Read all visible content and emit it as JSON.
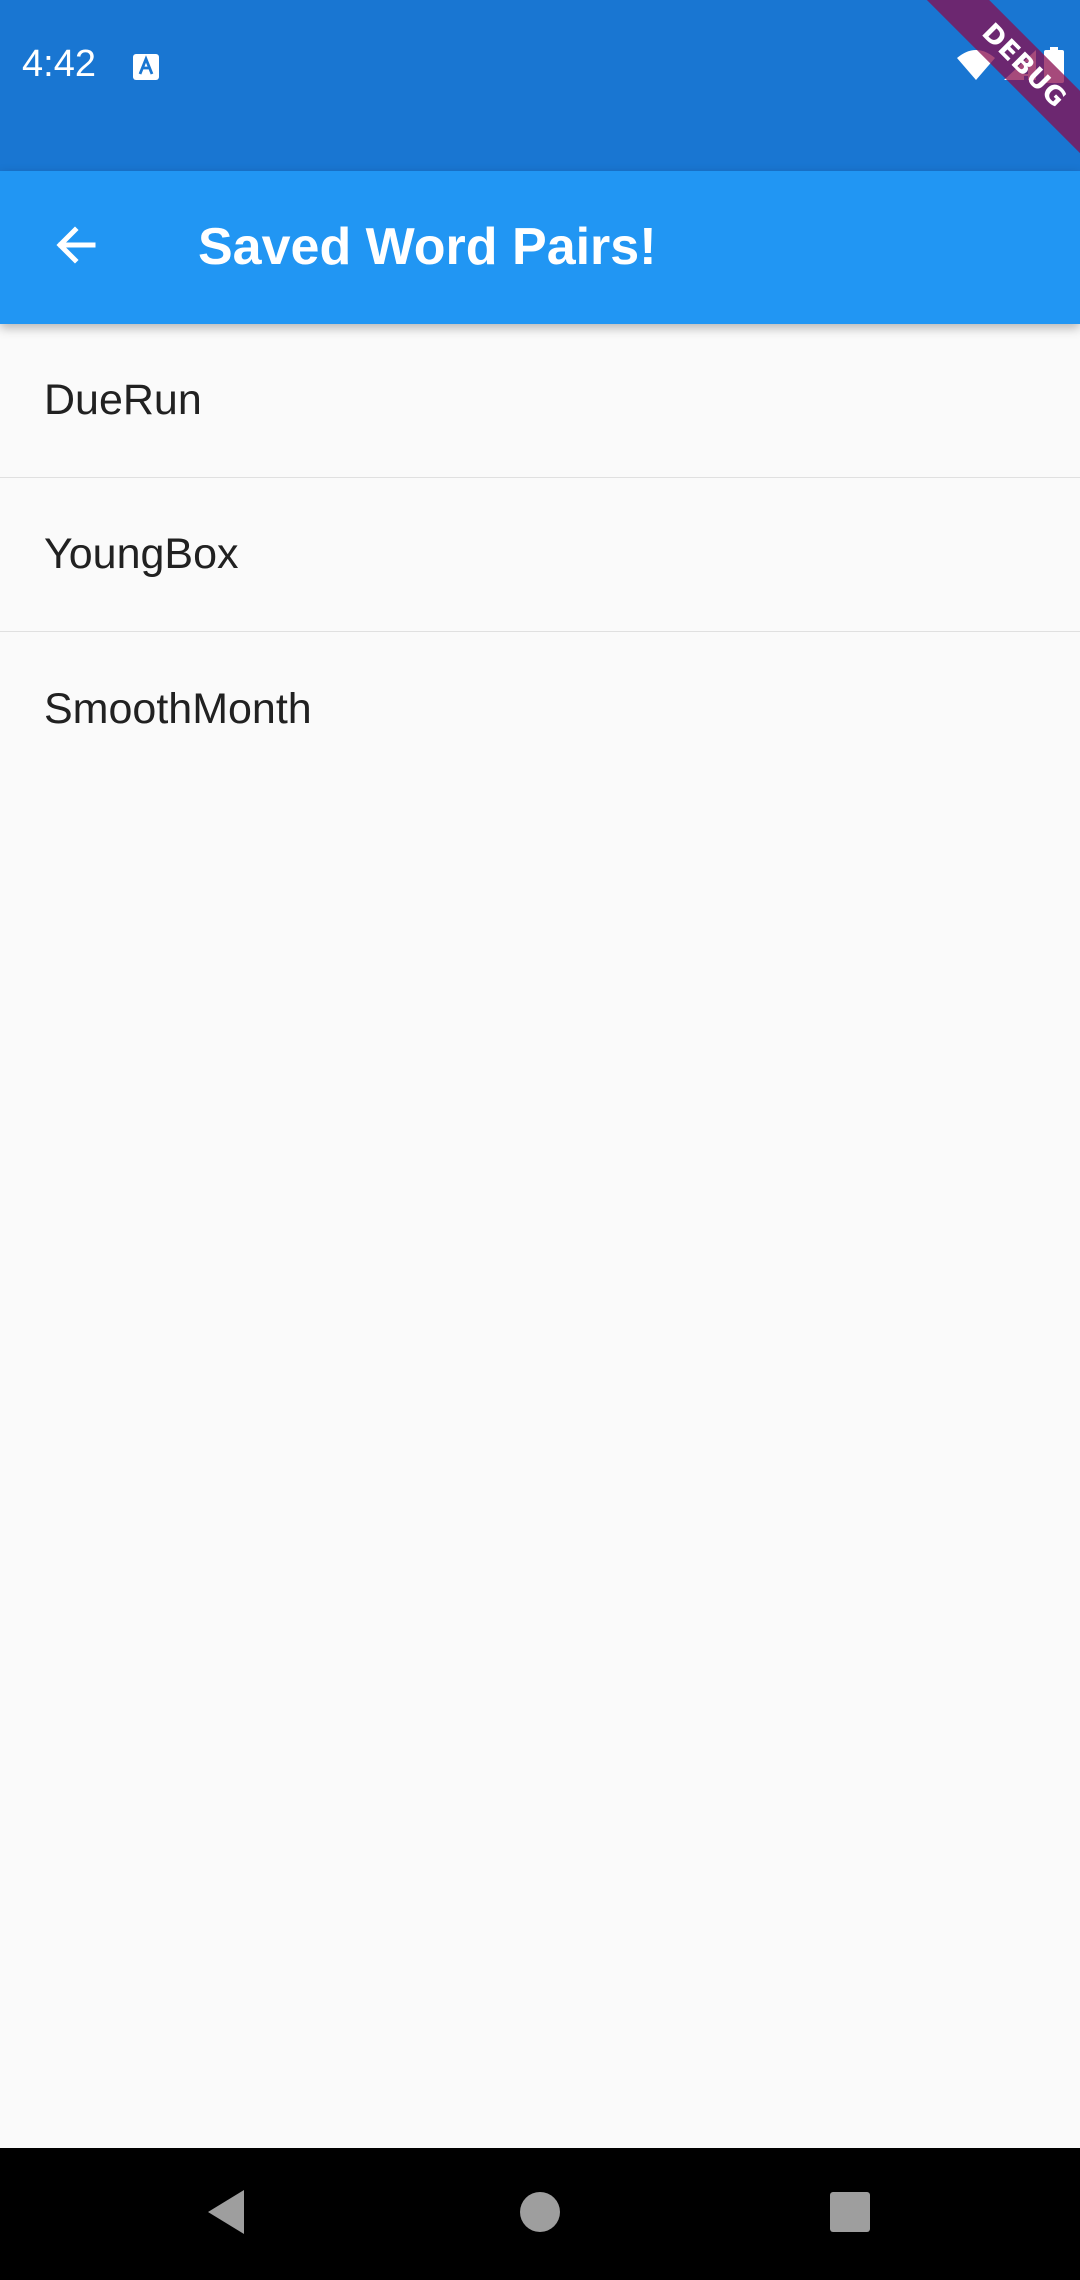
{
  "status_bar": {
    "time": "4:42",
    "background": "#1976d2",
    "icons": [
      "a-notification-icon",
      "wifi-icon",
      "cell-signal-icon",
      "battery-icon"
    ]
  },
  "debug_banner": {
    "label": "DEBUG",
    "color": "#880e4f"
  },
  "app_bar": {
    "title": "Saved Word Pairs!",
    "back_icon": "arrow-back-icon",
    "background": "#2196f3"
  },
  "saved_pairs": [
    {
      "label": "DueRun"
    },
    {
      "label": "YoungBox"
    },
    {
      "label": "SmoothMonth"
    }
  ],
  "nav_bar": {
    "buttons": [
      "back-triangle-icon",
      "home-circle-icon",
      "recents-square-icon"
    ]
  }
}
